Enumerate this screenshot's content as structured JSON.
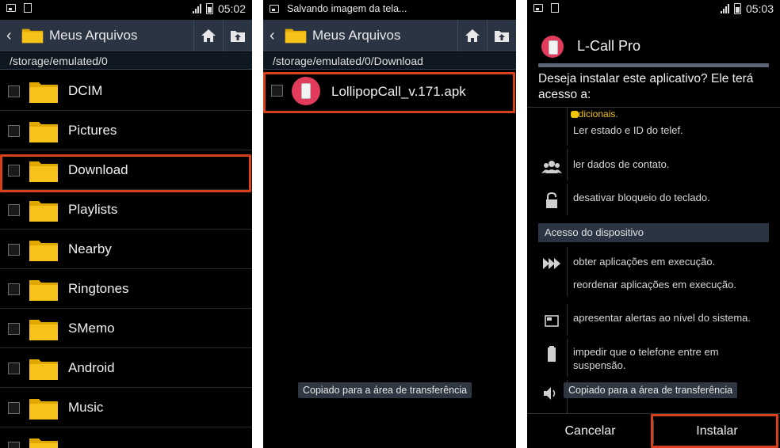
{
  "panel1": {
    "status": {
      "time": "05:02"
    },
    "actionbar": {
      "title": "Meus Arquivos"
    },
    "path": "/storage/emulated/0",
    "folders": [
      {
        "name": "DCIM"
      },
      {
        "name": "Pictures"
      },
      {
        "name": "Download"
      },
      {
        "name": "Playlists"
      },
      {
        "name": "Nearby"
      },
      {
        "name": "Ringtones"
      },
      {
        "name": "SMemo"
      },
      {
        "name": "Android"
      },
      {
        "name": "Music"
      }
    ],
    "highlighted": "Download"
  },
  "panel2": {
    "status": {
      "notification": "Salvando imagem da tela..."
    },
    "actionbar": {
      "title": "Meus Arquivos"
    },
    "path": "/storage/emulated/0/Download",
    "files": [
      {
        "name": "LollipopCall_v.171.apk"
      }
    ],
    "toast": "Copiado para a área de transferência"
  },
  "panel3": {
    "status": {
      "time": "05:03"
    },
    "app_name": "L-Call Pro",
    "question": "Deseja instalar este aplicativo? Ele terá acesso a:",
    "permissions": {
      "partial_top": "adicionais.",
      "phone_state": "Ler estado e ID do telef.",
      "contacts": "ler dados de contato.",
      "keylock": "desativar bloqueio do teclado."
    },
    "section_device": "Acesso do dispositivo",
    "device_permissions": {
      "get_tasks": "obter aplicações em execução.",
      "reorder_tasks": "reordenar aplicações em execução.",
      "system_alert": "apresentar alertas ao nível do sistema.",
      "wake_lock": "impedir que o telefone entre em suspensão."
    },
    "toast": "Copiado para a área de transferência",
    "buttons": {
      "cancel": "Cancelar",
      "install": "Instalar"
    }
  },
  "colors": {
    "highlight": "#d74019",
    "actionbar": "#2b3442",
    "folder": "#f7c21a",
    "app_icon": "#e23c5c"
  }
}
